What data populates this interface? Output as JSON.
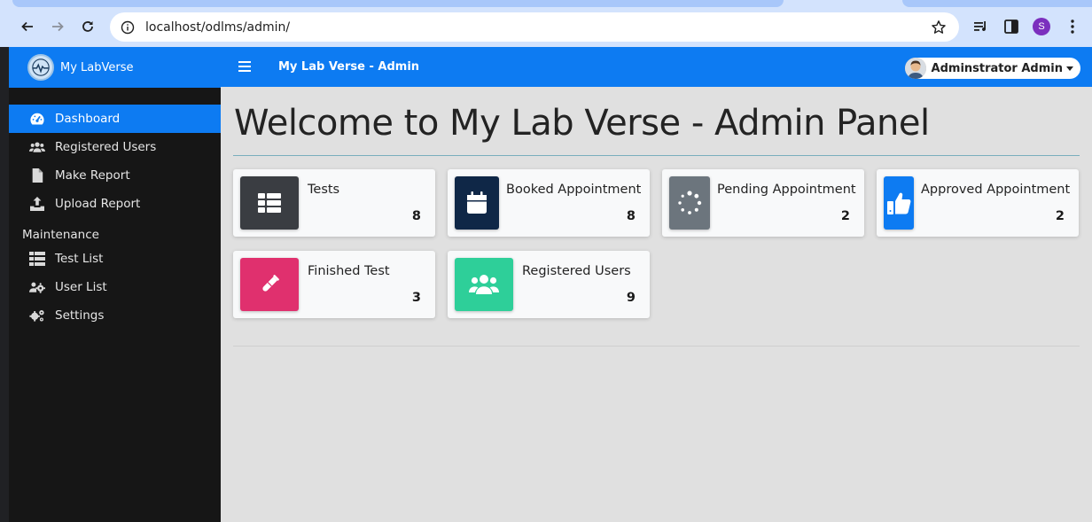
{
  "browser": {
    "url": "localhost/odlms/admin/",
    "profile_initial": "S"
  },
  "sidebar": {
    "brand_name": "My LabVerse",
    "items": [
      {
        "label": "Dashboard",
        "icon": "gauge-icon",
        "active": true
      },
      {
        "label": "Registered Users",
        "icon": "users-icon",
        "active": false
      },
      {
        "label": "Make Report",
        "icon": "file-icon",
        "active": false
      },
      {
        "label": "Upload Report",
        "icon": "upload-icon",
        "active": false
      }
    ],
    "section_header": "Maintenance",
    "maintenance_items": [
      {
        "label": "Test List",
        "icon": "table-list-icon"
      },
      {
        "label": "User List",
        "icon": "users-cog-icon"
      },
      {
        "label": "Settings",
        "icon": "gears-icon"
      }
    ]
  },
  "header": {
    "title": "My Lab Verse - Admin",
    "user_name": "Adminstrator Admin"
  },
  "main": {
    "page_title": "Welcome to My Lab Verse - Admin Panel",
    "cards": [
      {
        "label": "Tests",
        "value": "8",
        "color": "#3a3d42",
        "icon": "table-icon"
      },
      {
        "label": "Booked Appointment",
        "value": "8",
        "color": "#0f2747",
        "icon": "calendar-icon"
      },
      {
        "label": "Pending Appointment",
        "value": "2",
        "color": "#6c757d",
        "icon": "spinner-icon"
      },
      {
        "label": "Approved Appointment",
        "value": "2",
        "color": "#0d7bf2",
        "icon": "thumbs-up-icon"
      },
      {
        "label": "Finished Test",
        "value": "3",
        "color": "#e0306e",
        "icon": "test-tube-icon"
      },
      {
        "label": "Registered Users",
        "value": "9",
        "color": "#2ecf99",
        "icon": "users-icon"
      }
    ]
  }
}
